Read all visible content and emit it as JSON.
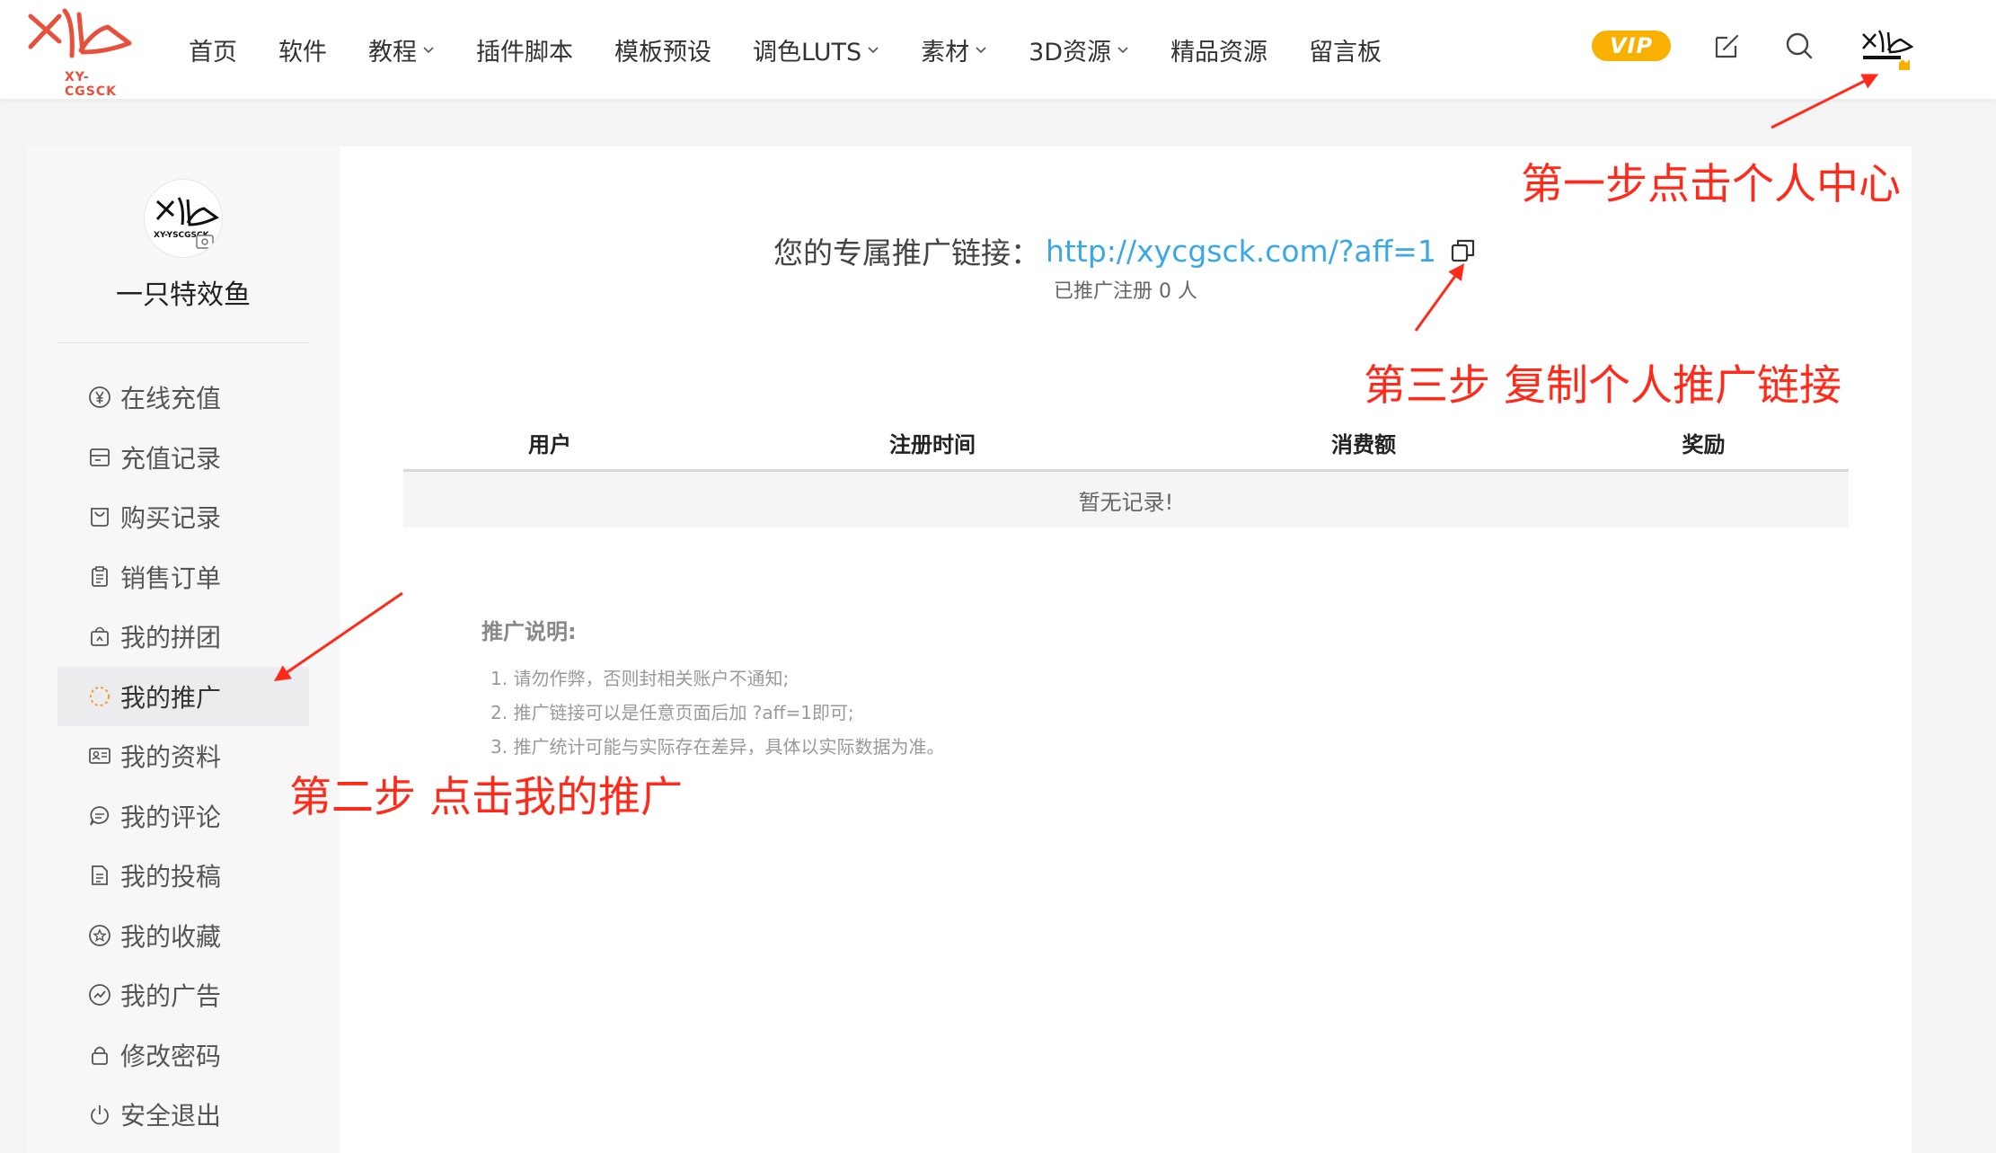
{
  "header": {
    "logo_text": "XY-CGSCK",
    "nav": [
      {
        "label": "首页",
        "has_dropdown": false
      },
      {
        "label": "软件",
        "has_dropdown": false
      },
      {
        "label": "教程",
        "has_dropdown": true
      },
      {
        "label": "插件脚本",
        "has_dropdown": false
      },
      {
        "label": "模板预设",
        "has_dropdown": false
      },
      {
        "label": "调色LUTS",
        "has_dropdown": true
      },
      {
        "label": "素材",
        "has_dropdown": true
      },
      {
        "label": "3D资源",
        "has_dropdown": true
      },
      {
        "label": "精品资源",
        "has_dropdown": false
      },
      {
        "label": "留言板",
        "has_dropdown": false
      }
    ],
    "vip_label": "VIP",
    "icons": [
      "edit-icon",
      "search-icon",
      "user-avatar"
    ]
  },
  "sidebar": {
    "avatar_text": "XY-YSCGSCK",
    "username": "一只特效鱼",
    "menu": [
      {
        "label": "在线充值",
        "icon": "yen-circle-icon"
      },
      {
        "label": "充值记录",
        "icon": "record-icon"
      },
      {
        "label": "购买记录",
        "icon": "bag-icon"
      },
      {
        "label": "销售订单",
        "icon": "clipboard-icon"
      },
      {
        "label": "我的拼团",
        "icon": "group-buy-icon"
      },
      {
        "label": "我的推广",
        "icon": "loading-circle-icon",
        "active": true
      },
      {
        "label": "我的资料",
        "icon": "id-card-icon"
      },
      {
        "label": "我的评论",
        "icon": "comment-icon"
      },
      {
        "label": "我的投稿",
        "icon": "document-icon"
      },
      {
        "label": "我的收藏",
        "icon": "star-circle-icon"
      },
      {
        "label": "我的广告",
        "icon": "chart-circle-icon"
      },
      {
        "label": "修改密码",
        "icon": "lock-icon"
      },
      {
        "label": "安全退出",
        "icon": "power-icon"
      }
    ]
  },
  "main": {
    "aff_label": "您的专属推广链接：",
    "aff_link": "http://xycgsck.com/?aff=1",
    "aff_count": "已推广注册 0 人",
    "table": {
      "headers": [
        "用户",
        "注册时间",
        "消费额",
        "奖励"
      ],
      "empty_text": "暂无记录!"
    },
    "description": {
      "title": "推广说明:",
      "items": [
        "1. 请勿作弊，否则封相关账户不通知;",
        "2. 推广链接可以是任意页面后加 ?aff=1即可;",
        "3. 推广统计可能与实际存在差异，具体以实际数据为准。"
      ]
    }
  },
  "annotations": {
    "step1": "第一步点击个人中心",
    "step2": "第二步 点击我的推广",
    "step3": "第三步 复制个人推广链接",
    "color": "#ff2a1a"
  },
  "colors": {
    "brand_red": "#e8503b",
    "vip_gold": "#f9b000",
    "link_blue": "#3aa7e6",
    "active_orange": "#f39a2c"
  }
}
